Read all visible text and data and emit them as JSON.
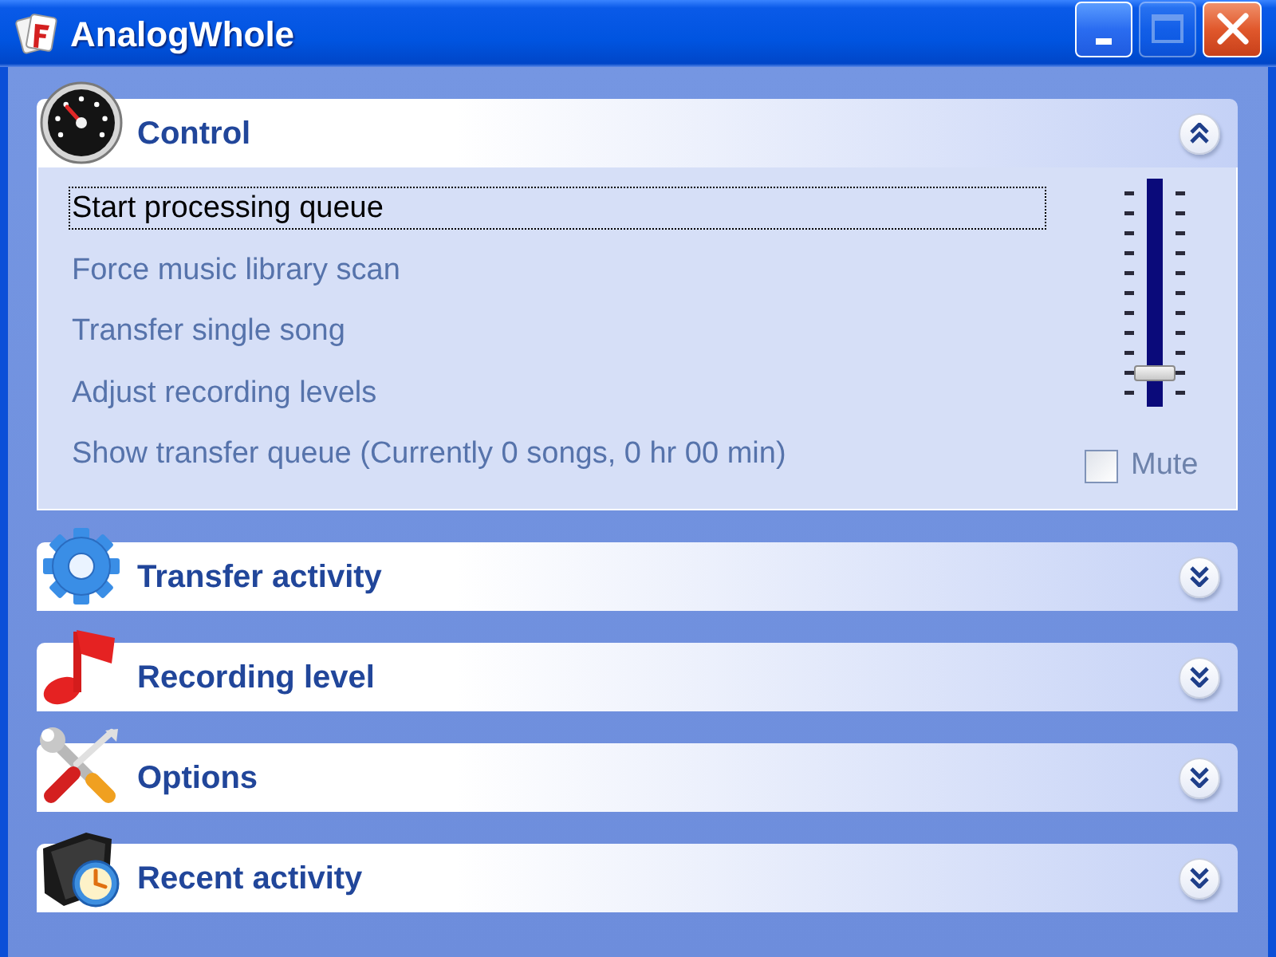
{
  "window": {
    "title": "AnalogWhole",
    "controls": [
      {
        "kind": "minimize",
        "disabled": false
      },
      {
        "kind": "maximize",
        "disabled": true
      },
      {
        "kind": "close",
        "disabled": false
      }
    ]
  },
  "panels": [
    {
      "title": "Control",
      "expanded": true,
      "tasks": [
        {
          "label": "Start processing queue",
          "focused": true
        },
        {
          "label": "Force music library scan",
          "focused": false
        },
        {
          "label": "Transfer single song",
          "focused": false
        },
        {
          "label": "Adjust recording levels",
          "focused": false
        },
        {
          "label": "Show transfer queue (Currently 0 songs, 0 hr 00 min)",
          "focused": false
        }
      ],
      "slider": {
        "level": 0.1
      },
      "mute": {
        "label": "Mute",
        "checked": false
      }
    },
    {
      "title": "Transfer activity",
      "expanded": false
    },
    {
      "title": "Recording level",
      "expanded": false
    },
    {
      "title": "Options",
      "expanded": false
    },
    {
      "title": "Recent activity",
      "expanded": false
    }
  ]
}
